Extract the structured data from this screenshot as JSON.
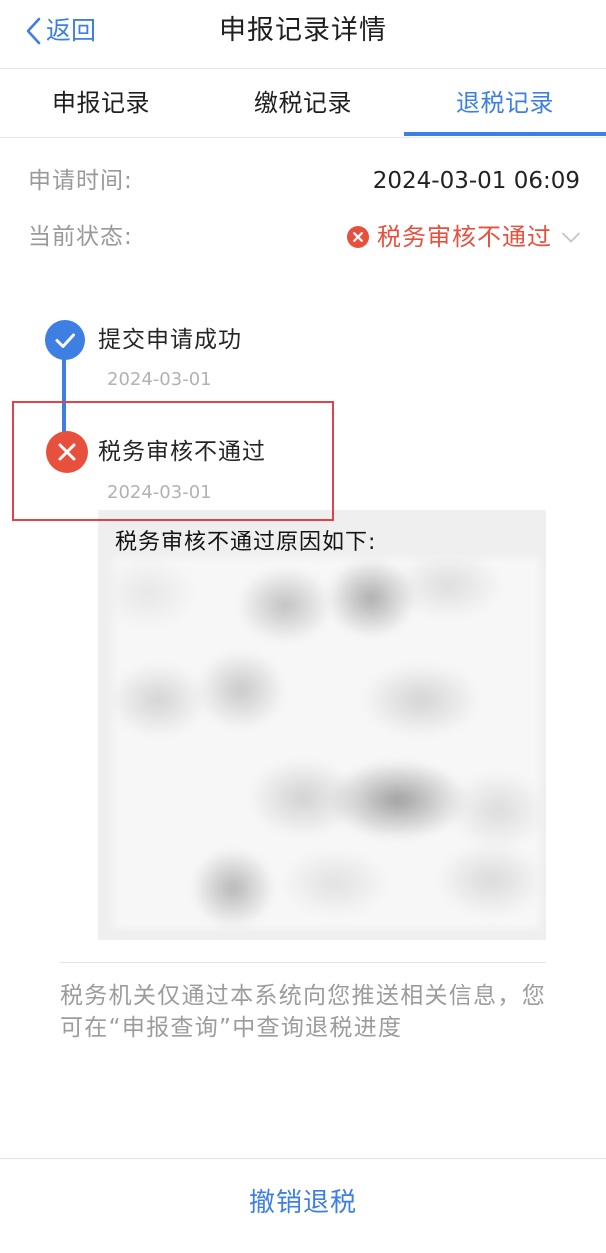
{
  "colors": {
    "brand_blue": "#3d7fe2",
    "error_red": "#e8503e",
    "annotation_red": "#e04444"
  },
  "navbar": {
    "back_icon": "chevron-left-icon",
    "back_label": "返回",
    "title": "申报记录详情"
  },
  "tabs": [
    {
      "label": "申报记录",
      "active": false
    },
    {
      "label": "缴税记录",
      "active": false
    },
    {
      "label": "退税记录",
      "active": true
    }
  ],
  "details": {
    "apply_time": {
      "label": "申请时间:",
      "value": "2024-03-01 06:09"
    },
    "status": {
      "label": "当前状态:",
      "icon": "x-circle-icon",
      "value": "税务审核不通过",
      "expand_icon": "chevron-down-icon"
    }
  },
  "timeline": [
    {
      "icon": "check-icon",
      "title": "提交申请成功",
      "date": "2024-03-01",
      "highlighted": false
    },
    {
      "icon": "x-icon",
      "title": "税务审核不通过",
      "date": "2024-03-01",
      "highlighted": true
    }
  ],
  "reason": {
    "heading": "税务审核不通过原因如下:",
    "content_blurred": true
  },
  "notice": "税务机关仅通过本系统向您推送相关信息，您可在“申报查询”中查询退税进度",
  "footer": {
    "action_label": "撤销退税"
  }
}
